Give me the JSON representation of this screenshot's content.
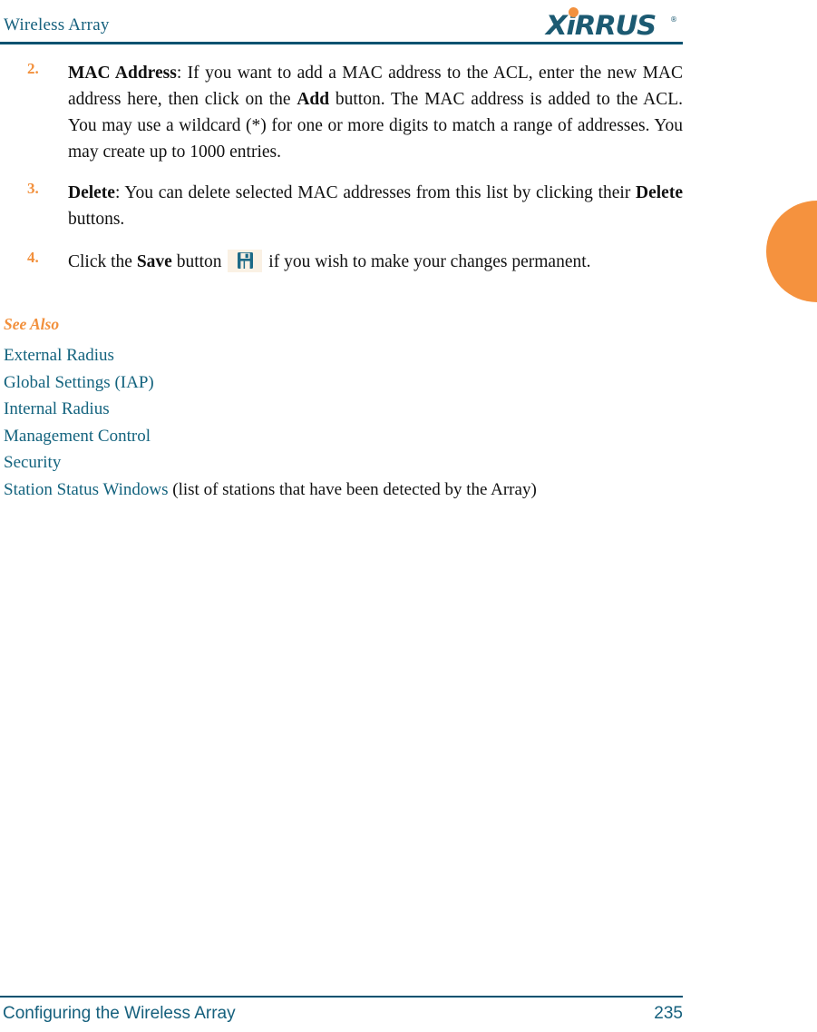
{
  "header": {
    "title": "Wireless Array",
    "logo": {
      "wordmark": "XiRRUS",
      "registered_mark": "®",
      "dot_color": "#F2913E",
      "text_color": "#1C5A72"
    },
    "rule_color": "#005270"
  },
  "tab_marker": {
    "color": "#F5923E",
    "shape": "half-circle"
  },
  "steps": [
    {
      "number": "2.",
      "lead": "MAC Address",
      "body_1": ": If you want to add a MAC address to the ACL, enter the new MAC address here, then click on the ",
      "bold_2": "Add",
      "body_2": " button. The MAC address is added to the ACL. You may use a wildcard (*) for one or more digits to match a range of addresses. You may create up to 1000 entries."
    },
    {
      "number": "3.",
      "lead": "Delete",
      "body_1": ": You can delete selected MAC addresses from this list by clicking their ",
      "bold_2": "Delete",
      "body_2": " buttons."
    },
    {
      "number": "4.",
      "body_1": "Click the ",
      "bold_1": "Save",
      "body_2": " button ",
      "icon": "save-floppy-icon",
      "body_3": " if you wish to make your changes permanent."
    }
  ],
  "see_also": {
    "heading": "See Also",
    "links": [
      "External Radius",
      "Global Settings (IAP)",
      "Internal Radius",
      "Management Control",
      "Security",
      "Station Status Windows"
    ],
    "last_link_note": " (list of stations that have been detected by the Array)",
    "link_color": "#13637E",
    "heading_color": "#F2903C"
  },
  "footer": {
    "left": "Configuring the Wireless Array",
    "page_number": "235",
    "rule_color": "#005270"
  },
  "colors": {
    "teal": "#15607D",
    "orange": "#F2903C",
    "icon_bg": "#FAF1E4"
  }
}
